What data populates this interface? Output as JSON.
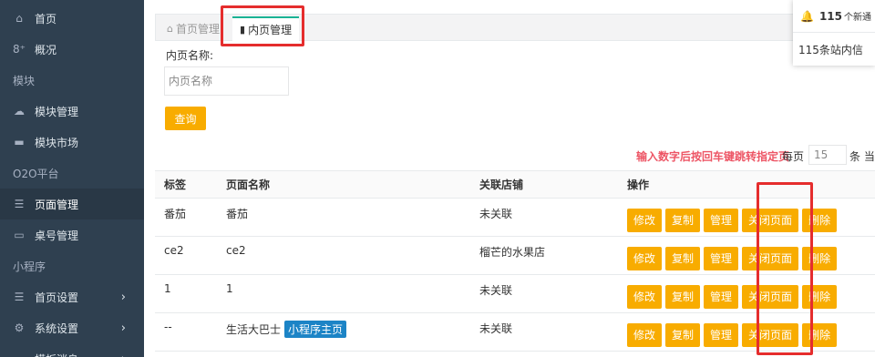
{
  "sidebar": {
    "items": [
      {
        "label": "首页",
        "icon": "home-icon",
        "glyph": "⌂"
      },
      {
        "label": "概况",
        "icon": "google-plus-icon",
        "glyph": "8⁺"
      },
      {
        "section": "模块"
      },
      {
        "label": "模块管理",
        "icon": "cloud-icon",
        "glyph": "☁"
      },
      {
        "label": "模块市场",
        "icon": "keyboard-icon",
        "glyph": "▬"
      },
      {
        "section": "O2O平台"
      },
      {
        "label": "页面管理",
        "icon": "list-icon",
        "glyph": "☰"
      },
      {
        "label": "桌号管理",
        "icon": "laptop-icon",
        "glyph": "▭"
      },
      {
        "section": "小程序"
      },
      {
        "label": "首页设置",
        "icon": "list-icon",
        "glyph": "☰",
        "arrow": "›"
      },
      {
        "label": "系统设置",
        "icon": "cogs-icon",
        "glyph": "⚙",
        "arrow": "›"
      },
      {
        "label": "模板消息",
        "icon": "cloud-icon",
        "glyph": "☁",
        "arrow": "›"
      }
    ]
  },
  "tabs": {
    "home": "首页管理",
    "current": "内页管理"
  },
  "search": {
    "label": "内页名称:",
    "placeholder": "内页名称",
    "button": "查询"
  },
  "pager": {
    "hint": "输入数字后按回车键跳转指定页",
    "per_page_label": "每页",
    "per_page_value": "15",
    "tail": "条 当"
  },
  "table": {
    "headers": [
      "标签",
      "页面名称",
      "关联店铺",
      "操作"
    ],
    "rows": [
      {
        "tag": "番茄",
        "name": "番茄",
        "badge": "",
        "shop": "未关联"
      },
      {
        "tag": "ce2",
        "name": "ce2",
        "badge": "",
        "shop": "榴芒的水果店"
      },
      {
        "tag": "1",
        "name": "1",
        "badge": "",
        "shop": "未关联"
      },
      {
        "tag": "--",
        "name": "生活大巴士",
        "badge": "小程序主页",
        "shop": "未关联"
      }
    ],
    "actions": [
      "修改",
      "复制",
      "管理",
      "关闭页面",
      "删除"
    ]
  },
  "notification": {
    "count": "115",
    "title_suffix": "个新通",
    "message": "115条站内信"
  },
  "colors": {
    "sidebar_bg": "#2f4050",
    "accent_orange": "#f8ac00",
    "highlight_red": "#e52d2d",
    "hint_red": "#ed5565",
    "badge_blue": "#1c84c6"
  }
}
